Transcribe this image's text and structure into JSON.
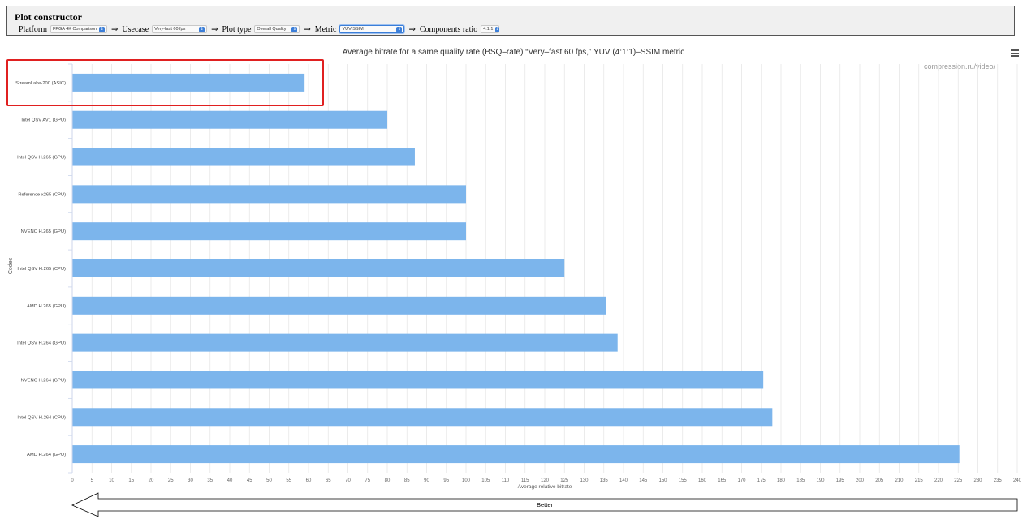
{
  "constructor": {
    "title": "Plot constructor",
    "platform_label": "Platform",
    "platform_value": "FPGA 4K Comparison",
    "usecase_label": "Usecase",
    "usecase_value": "Very-fast 60 fps",
    "plot_type_label": "Plot type",
    "plot_type_value": "Overall Quality",
    "metric_label": "Metric",
    "metric_value": "YUV-SSIM",
    "ratio_label": "Components ratio",
    "ratio_value": "4:1:1",
    "arrow": "⇒"
  },
  "credit": "compression.ru/video/",
  "colors": {
    "bar": "#7cb5ec",
    "highlight": "#e02020",
    "grid": "#e6e6e6"
  },
  "chart_data": {
    "type": "bar",
    "orientation": "horizontal",
    "title": "Average bitrate for a same quality rate (BSQ–rate) “Very–fast 60 fps,” YUV (4:1:1)–SSIM metric",
    "xlabel": "Average relative bitrate",
    "ylabel": "Codec",
    "xlim": [
      0,
      240
    ],
    "xticks": [
      0,
      5,
      10,
      15,
      20,
      25,
      30,
      35,
      40,
      45,
      50,
      55,
      60,
      65,
      70,
      75,
      80,
      85,
      90,
      95,
      100,
      105,
      110,
      115,
      120,
      125,
      130,
      135,
      140,
      145,
      150,
      155,
      160,
      165,
      170,
      175,
      180,
      185,
      190,
      195,
      200,
      205,
      210,
      215,
      220,
      225,
      230,
      235,
      240
    ],
    "grid": true,
    "categories": [
      "StreamLake-200 (ASIC)",
      "Intel QSV AV1 (GPU)",
      "Intel QSV H.265 (GPU)",
      "Reference x265 (CPU)",
      "NVENC H.265 (GPU)",
      "Intel QSV H.265 (CPU)",
      "AMD H.265 (GPU)",
      "Intel QSV H.264 (GPU)",
      "NVENC H.264 (GPU)",
      "Intel QSV H.264 (CPU)",
      "AMD H.264 (GPU)"
    ],
    "values": [
      59,
      80,
      87,
      100,
      100,
      125,
      135.5,
      138.5,
      175.5,
      177.8,
      225.3
    ],
    "highlighted_category": "StreamLake-200 (ASIC)",
    "direction_arrow_label": "Better"
  }
}
